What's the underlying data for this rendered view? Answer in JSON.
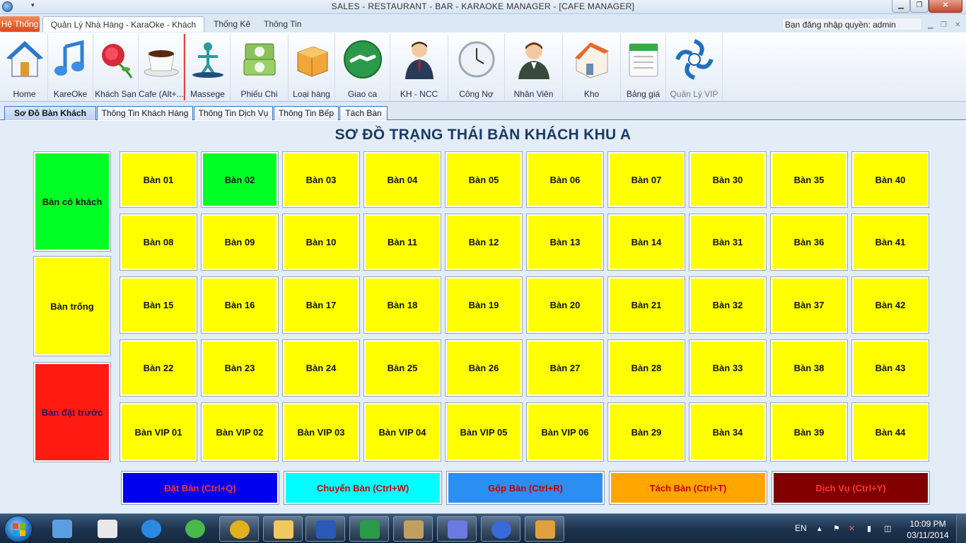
{
  "window": {
    "title": "SALES - RESTAURANT - BAR - KARAOKE MANAGER - [CAFE MANAGER]",
    "minimize_glyph": "▁",
    "maximize_glyph": "❐",
    "close_glyph": "✕",
    "qa_arrow": "▾"
  },
  "ribbon_tabs": {
    "system": "Hệ Thống",
    "active": "Quản Lý Nhà Hàng - KaraOke - Khách Sạn",
    "stats": "Thống Kê",
    "info": "Thông Tin"
  },
  "login": {
    "label": "Bạn đăng nhập quyền: admin",
    "controls": [
      "▁",
      "❐",
      "✕"
    ]
  },
  "ribbon_buttons": [
    {
      "label": "Home",
      "icon": "home-icon"
    },
    {
      "label": "KareOke",
      "icon": "music-note-icon"
    },
    {
      "label": "Khách Sạn",
      "icon": "rose-icon"
    },
    {
      "label": "Cafe (Alt+...",
      "icon": "coffee-cup-icon"
    },
    {
      "label": "Massege",
      "icon": "massage-icon"
    },
    {
      "label": "Phiếu Chi",
      "icon": "money-icon"
    },
    {
      "label": "Loại hàng",
      "icon": "box-icon"
    },
    {
      "label": "Giao ca",
      "icon": "handshake-icon"
    },
    {
      "label": "KH - NCC",
      "icon": "businessman-icon"
    },
    {
      "label": "Công Nợ",
      "icon": "clock-icon"
    },
    {
      "label": "Nhân Viên",
      "icon": "employee-icon"
    },
    {
      "label": "Kho",
      "icon": "warehouse-icon"
    },
    {
      "label": "Bảng giá",
      "icon": "price-list-icon"
    },
    {
      "label": "Quản Lý VIP",
      "icon": "vip-logo-icon"
    }
  ],
  "sub_tabs": [
    "Sơ Đồ Bàn Khách",
    "Thông Tin Khách Hàng",
    "Thông Tin Dịch Vụ",
    "Thông Tin Bếp",
    "Tách Bàn"
  ],
  "main": {
    "title": "SƠ ĐỒ TRẠNG THÁI BÀN KHÁCH KHU A"
  },
  "legend": {
    "occupied": "Bàn có khách",
    "empty": "Bàn trống",
    "reserved": "Bàn đặt trước"
  },
  "tables": [
    [
      "Bàn 01",
      "Bàn 02",
      "Bàn 03",
      "Bàn 04",
      "Bàn 05",
      "Bàn 06",
      "Bàn 07",
      "Bàn 30",
      "Bàn 35",
      "Bàn 40"
    ],
    [
      "Bàn 08",
      "Bàn 09",
      "Bàn 10",
      "Bàn 11",
      "Bàn 12",
      "Bàn 13",
      "Bàn 14",
      "Bàn 31",
      "Bàn 36",
      "Bàn 41"
    ],
    [
      "Bàn 15",
      "Bàn 16",
      "Bàn 17",
      "Bàn 18",
      "Bàn 19",
      "Bàn 20",
      "Bàn 21",
      "Bàn 32",
      "Bàn 37",
      "Bàn 42"
    ],
    [
      "Bàn 22",
      "Bàn 23",
      "Bàn 24",
      "Bàn 25",
      "Bàn 26",
      "Bàn 27",
      "Bàn 28",
      "Bàn 33",
      "Bàn 38",
      "Bàn 43"
    ],
    [
      "Bàn VIP 01",
      "Bàn VIP 02",
      "Bàn VIP 03",
      "Bàn VIP 04",
      "Bàn VIP 05",
      "Bàn VIP 06",
      "Bàn 29",
      "Bàn 34",
      "Bàn 39",
      "Bàn 44"
    ]
  ],
  "occupied_tables": [
    "Bàn 02"
  ],
  "colors": {
    "occupied": "#00ff25",
    "empty": "#ffff00",
    "reserved": "#ff1a12"
  },
  "actions": [
    {
      "label": "Đặt Bàn (Ctrl+Q)",
      "bg": "#0000ee",
      "fg": "#ff3030"
    },
    {
      "label": "Chuyển Bàn (Ctrl+W)",
      "bg": "#00ffff",
      "fg": "#cc0000"
    },
    {
      "label": "Gộp Bàn (Ctrl+R)",
      "bg": "#2b8ef0",
      "fg": "#cc0000"
    },
    {
      "label": "Tách Bàn (Ctrl+T)",
      "bg": "#ffa500",
      "fg": "#cc0000"
    },
    {
      "label": "Dịch Vụ (Ctrl+Y)",
      "bg": "#800000",
      "fg": "#ff3030"
    }
  ],
  "taskbar": {
    "apps": [
      "control-panel-icon",
      "unikey-icon",
      "internet-explorer-icon",
      "coccoc-icon",
      "chrome-icon",
      "file-explorer-icon",
      "word-icon",
      "excel-icon",
      "tools-icon",
      "infinity-icon",
      "itunes-icon",
      "paint-icon"
    ],
    "language": "EN",
    "time": "10:09 PM",
    "date": "03/11/2014",
    "tray_glyphs": [
      "▴",
      "⚑",
      "✕",
      "▮",
      "◫"
    ]
  }
}
